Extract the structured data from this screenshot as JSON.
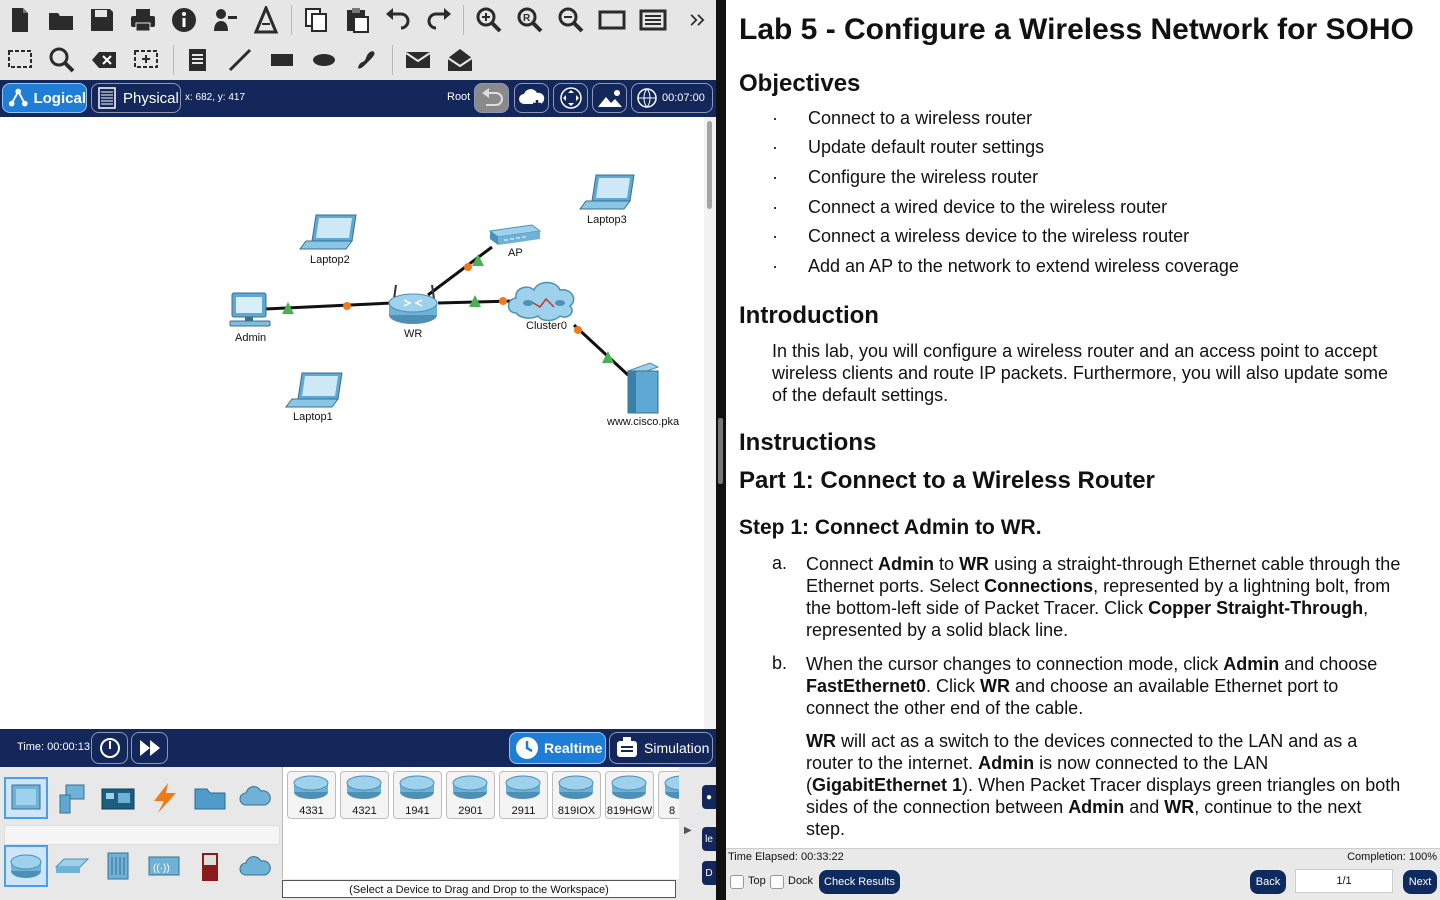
{
  "left": {
    "view_tabs": {
      "logical": "Logical",
      "physical": "Physical"
    },
    "coords": "x: 682, y: 417",
    "root_label": "Root",
    "clock": "00:07:00",
    "devices": {
      "admin": "Admin",
      "wr": "WR",
      "ap": "AP",
      "cluster": "Cluster0",
      "server": "www.cisco.pka",
      "laptop1": "Laptop1",
      "laptop2": "Laptop2",
      "laptop3": "Laptop3"
    },
    "time": "Time: 00:00:13",
    "realtime": "Realtime",
    "simulation": "Simulation",
    "models": [
      "4331",
      "4321",
      "1941",
      "2901",
      "2911",
      "819IOX",
      "819HGW",
      "8"
    ],
    "hint": "(Select a Device to Drag and Drop to the Workspace)",
    "side_chips": [
      "le",
      "D"
    ],
    "colors": {
      "nav_bg": "#13275a",
      "active_btn": "#1f7dd6",
      "link_up": "#4caf50",
      "link_mid": "#f07a1a"
    }
  },
  "doc": {
    "title": "Lab 5 - Configure a Wireless Network for SOHO",
    "objectives_heading": "Objectives",
    "objectives": [
      "Connect to a wireless router",
      "Update default router settings",
      "Configure the wireless router",
      "Connect a wired device to the wireless router",
      "Connect a wireless device to the wireless router",
      "Add an AP to the network to extend wireless coverage"
    ],
    "bullet": "·",
    "intro_heading": "Introduction",
    "intro_lines": [
      "In this lab, you will configure a wireless router and an access point to accept",
      "wireless clients and route IP packets. Furthermore, you will also update some",
      "of the default settings."
    ],
    "instructions_heading": "Instructions",
    "part1_heading": "Part 1: Connect to a Wireless Router",
    "step1_heading": "Step 1: Connect Admin to WR.",
    "step_a_letter": "a.",
    "step_b_letter": "b."
  },
  "footer": {
    "elapsed": "Time Elapsed: 00:33:22",
    "completion": "Completion: 100%",
    "top": "Top",
    "dock": "Dock",
    "check": "Check Results",
    "back": "Back",
    "page": "1/1",
    "next": "Next"
  }
}
